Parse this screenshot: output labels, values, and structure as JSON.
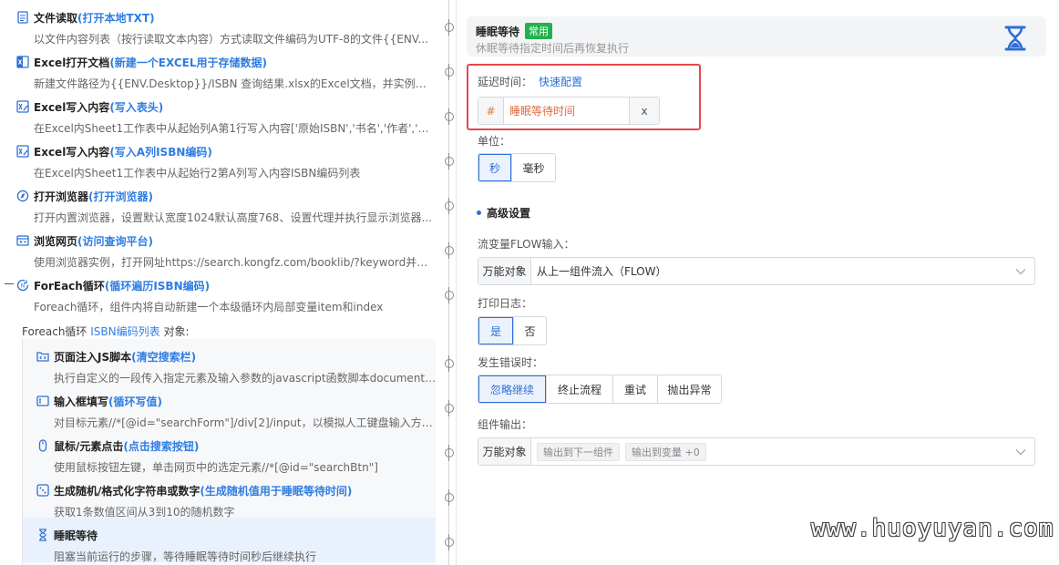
{
  "flow": {
    "steps": [
      {
        "icon": "file-icon",
        "name": "文件读取",
        "note": "(打开本地TXT)",
        "desc": "以文件内容列表（按行读取文本内容）方式读取文件编码为UTF-8的文件{{ENV..."
      },
      {
        "icon": "excel-icon",
        "name": "Excel打开文档",
        "note": "(新建一个EXCEL用于存储数据)",
        "desc": "新建文件路径为{{ENV.Desktop}}/ISBN 查询结果.xlsx的Excel文档，并实例化初..."
      },
      {
        "icon": "excel-write-icon",
        "name": "Excel写入内容",
        "note": "(写入表头)",
        "desc": "在Excel内Sheet1工作表中从起始列A第1行写入内容['原始ISBN','书名','作者','出..."
      },
      {
        "icon": "excel-write-icon",
        "name": "Excel写入内容",
        "note": "(写入A列ISBN编码)",
        "desc": "在Excel内Sheet1工作表中从起始行2第A列写入内容ISBN编码列表"
      },
      {
        "icon": "browser-icon",
        "name": "打开浏览器",
        "note": "(打开浏览器)",
        "desc": "打开内置浏览器，设置默认宽度1024默认高度768、设置代理并执行显示浏览器..."
      },
      {
        "icon": "webpage-icon",
        "name": "浏览网页",
        "note": "(访问查询平台)",
        "desc": "使用浏览器实例，打开网址https://search.kongfz.com/booklib/?keyword并设置U..."
      },
      {
        "icon": "loop-icon",
        "name": "ForEach循环",
        "note": " (循环遍历ISBN编码)",
        "desc": "Foreach循环，组件内将自动新建一个本级循环内局部变量item和index"
      }
    ],
    "foreach_header": {
      "prefix": "Foreach循环 ",
      "list": "ISBN编码列表",
      "suffix": " 对象:"
    },
    "nested": [
      {
        "icon": "script-icon",
        "name": "页面注入JS脚本",
        "note": "(清空搜索栏)",
        "desc": "执行自定义的一段传入指定元素及输入参数的javascript函数脚本document.g..."
      },
      {
        "icon": "input-icon",
        "name": "输入框填写",
        "note": "(循环写值)",
        "desc": "对目标元素//*[@id=\"searchForm\"]/div[2]/input，以模拟人工键盘输入方式写..."
      },
      {
        "icon": "mouse-icon",
        "name": "鼠标/元素点击",
        "note": "(点击搜索按钮)",
        "desc": "使用鼠标按钮左键，单击网页中的选定元素//*[@id=\"searchBtn\"]"
      },
      {
        "icon": "random-icon",
        "name": "生成随机/格式化字符串或数字",
        "note": "(生成随机值用于睡眠等待时间)",
        "desc": "获取1条数值区间从3到10的随机数字"
      },
      {
        "icon": "hourglass-icon",
        "name": "睡眠等待",
        "note": "",
        "desc": "阻塞当前运行的步骤，等待睡眠等待时间秒后继续执行"
      }
    ]
  },
  "panel": {
    "title": "睡眠等待",
    "badge": "常用",
    "subtitle": "休眠等待指定时间后再恢复执行",
    "delay_label": "延迟时间：",
    "quick_config": "快速配置",
    "delay_prefix": "#",
    "delay_value": "睡眠等待时间",
    "delay_clear": "x",
    "unit_label": "单位：",
    "unit_options": [
      "秒",
      "毫秒"
    ],
    "advanced": "高级设置",
    "flow_input_label": "流变量FLOW输入：",
    "flow_input_prefix": "万能对象",
    "flow_input_value": "从上一组件流入（FLOW）",
    "log_label": "打印日志：",
    "log_options": [
      "是",
      "否"
    ],
    "error_label": "发生错误时：",
    "error_options": [
      "忽略继续",
      "终止流程",
      "重试",
      "抛出异常"
    ],
    "output_label": "组件输出：",
    "output_prefix": "万能对象",
    "output_tags": [
      "输出到下一组件",
      "输出到变量 +0"
    ]
  },
  "colors": {
    "accent": "#2f6fd6",
    "badge": "#22b24c",
    "highlight_border": "#e5484d",
    "delay_text": "#e2683d"
  },
  "watermark": "www.huoyuyan.com"
}
